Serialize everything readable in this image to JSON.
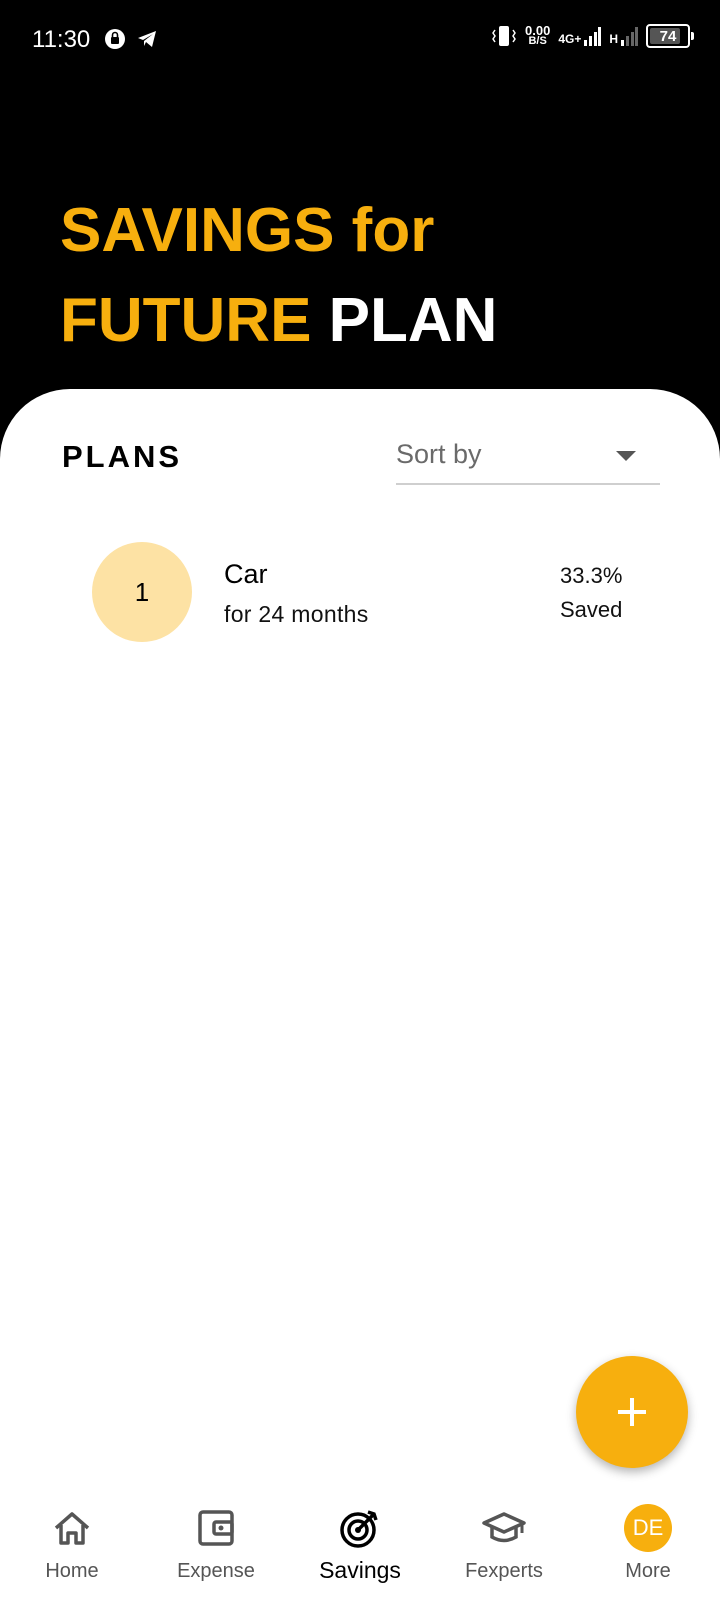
{
  "status_bar": {
    "time": "11:30",
    "net_speed_value": "0.00",
    "net_speed_unit": "B/S",
    "network_primary": "4G+",
    "network_secondary": "H",
    "battery": "74"
  },
  "hero": {
    "line1": "SAVINGS for",
    "line2_highlight": "FUTURE",
    "line2_rest": "PLAN"
  },
  "plans": {
    "title": "PLANS",
    "sort_label": "Sort by",
    "items": [
      {
        "index": "1",
        "name": "Car",
        "duration": "for 24 months",
        "percent": "33.3%",
        "status": "Saved"
      }
    ]
  },
  "bottom_nav": {
    "items": [
      {
        "label": "Home",
        "icon": "home-icon"
      },
      {
        "label": "Expense",
        "icon": "wallet-icon"
      },
      {
        "label": "Savings",
        "icon": "target-icon",
        "active": true
      },
      {
        "label": "Fexperts",
        "icon": "graduation-cap-icon"
      },
      {
        "label": "More",
        "avatar": "DE"
      }
    ]
  },
  "colors": {
    "accent": "#F7AF0E",
    "avatar_bg": "#FDE2A4",
    "header_bg": "#000000"
  }
}
